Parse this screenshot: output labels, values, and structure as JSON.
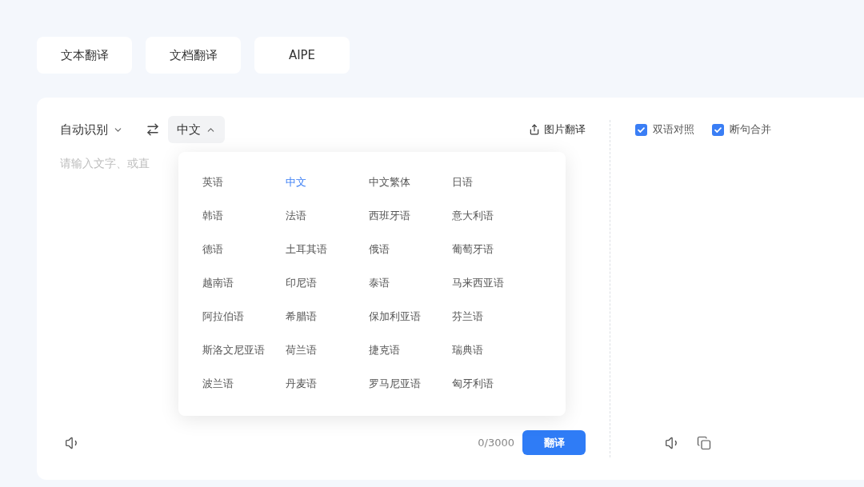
{
  "mode_tabs": [
    {
      "label": "文本翻译"
    },
    {
      "label": "文档翻译"
    },
    {
      "label": "AIPE"
    }
  ],
  "source_panel": {
    "source_language": {
      "label": "自动识别",
      "expanded": false
    },
    "target_language": {
      "label": "中文",
      "expanded": true
    },
    "image_translate": {
      "label": "图片翻译"
    },
    "input": {
      "placeholder": "请输入文字、或直"
    },
    "char_count": "0/3000",
    "translate_button": "翻译"
  },
  "language_menu": {
    "items": [
      {
        "label": "英语",
        "selected": false
      },
      {
        "label": "中文",
        "selected": true
      },
      {
        "label": "中文繁体",
        "selected": false
      },
      {
        "label": "日语",
        "selected": false
      },
      {
        "label": "韩语",
        "selected": false
      },
      {
        "label": "法语",
        "selected": false
      },
      {
        "label": "西班牙语",
        "selected": false
      },
      {
        "label": "意大利语",
        "selected": false
      },
      {
        "label": "德语",
        "selected": false
      },
      {
        "label": "土耳其语",
        "selected": false
      },
      {
        "label": "俄语",
        "selected": false
      },
      {
        "label": "葡萄牙语",
        "selected": false
      },
      {
        "label": "越南语",
        "selected": false
      },
      {
        "label": "印尼语",
        "selected": false
      },
      {
        "label": "泰语",
        "selected": false
      },
      {
        "label": "马来西亚语",
        "selected": false
      },
      {
        "label": "阿拉伯语",
        "selected": false
      },
      {
        "label": "希腊语",
        "selected": false
      },
      {
        "label": "保加利亚语",
        "selected": false
      },
      {
        "label": "芬兰语",
        "selected": false
      },
      {
        "label": "斯洛文尼亚语",
        "selected": false
      },
      {
        "label": "荷兰语",
        "selected": false
      },
      {
        "label": "捷克语",
        "selected": false
      },
      {
        "label": "瑞典语",
        "selected": false
      },
      {
        "label": "波兰语",
        "selected": false
      },
      {
        "label": "丹麦语",
        "selected": false
      },
      {
        "label": "罗马尼亚语",
        "selected": false
      },
      {
        "label": "匈牙利语",
        "selected": false
      }
    ]
  },
  "result_panel": {
    "options": [
      {
        "label": "双语对照",
        "checked": true
      },
      {
        "label": "断句合并",
        "checked": true
      }
    ]
  }
}
